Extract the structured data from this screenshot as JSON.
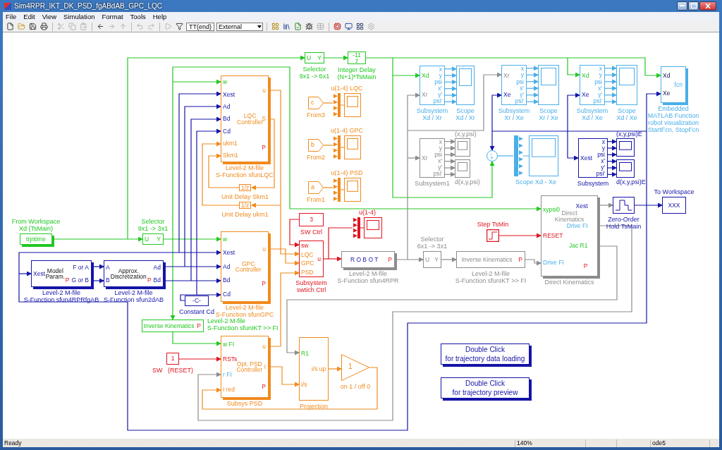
{
  "window": {
    "title": "Sim4RPR_IKT_DK_PSD_fgABdAB_GPC_LQC"
  },
  "menu": [
    "File",
    "Edit",
    "View",
    "Simulation",
    "Format",
    "Tools",
    "Help"
  ],
  "toolbar": {
    "stop_time": "TT(end)",
    "mode": "External"
  },
  "diagram": {
    "blocks": [
      {
        "kind": "block",
        "color": "#f08a1e",
        "inputs": [
          "w",
          "Xest",
          "Ad",
          "Bd",
          "Cd",
          "ukm1",
          "Skm1"
        ],
        "body": [
          "LQC",
          "Controller"
        ],
        "outputs": [
          "u",
          "S",
          "P"
        ],
        "caption": [
          "Level-2 M-file",
          "S-Function sfunLQC"
        ]
      },
      {
        "kind": "block",
        "color": "#22c822",
        "inputs": [
          "U"
        ],
        "outputs": [
          "Y"
        ],
        "caption": [
          "Selector",
          "9x1 -> 6x1"
        ]
      },
      {
        "kind": "block",
        "color": "#22c822",
        "body": [
          "-11",
          "z"
        ],
        "caption": [
          "Integer Delay",
          "(N+1)*TsMain"
        ]
      },
      {
        "kind": "from",
        "color": "#f08a1e",
        "body": [
          "c"
        ],
        "caption": [
          "From3"
        ]
      },
      {
        "kind": "mux_scope",
        "color": "#f08a1e",
        "caption": [
          "u(1-4) LQC"
        ]
      },
      {
        "kind": "block",
        "color": "#4aaee8",
        "inputs": [
          "Xd",
          "Xr"
        ],
        "outputs": [
          "x",
          "y",
          "psi",
          "x'",
          "y'",
          "psi'"
        ],
        "caption": [
          "Subsystem",
          "Xd / Xr"
        ]
      },
      {
        "kind": "scope",
        "color": "#4aaee8",
        "caption": [
          "Scope",
          "Xd / Xr"
        ]
      },
      {
        "kind": "block",
        "color": "#4aaee8",
        "inputs": [
          "Xr",
          "Xe"
        ],
        "outputs": [
          "x",
          "y",
          "psi",
          "x'",
          "y'",
          "psi'"
        ],
        "caption": [
          "Subsystem",
          "Xr / Xe"
        ]
      },
      {
        "kind": "scope",
        "color": "#4aaee8",
        "caption": [
          "Scope",
          "Xr / Xe"
        ]
      },
      {
        "kind": "block",
        "color": "#4aaee8",
        "inputs": [
          "Xd",
          "Xe"
        ],
        "outputs": [
          "x",
          "y",
          "psi",
          "x'",
          "y'",
          "psi'"
        ],
        "caption": [
          "Subsystem",
          "Xd / Xe"
        ]
      },
      {
        "kind": "scope",
        "color": "#4aaee8",
        "caption": [
          "Scope",
          "Xd / Xe"
        ]
      },
      {
        "kind": "block",
        "color": "#4aaee8",
        "inputs": [
          "Xd",
          "Xe"
        ],
        "body": [
          "fcn"
        ],
        "caption": [
          "Embedded",
          "MATLAB Function",
          "robot visualization",
          "StartFcn, StopFcn"
        ]
      },
      {
        "kind": "from",
        "color": "#f08a1e",
        "body": [
          "b"
        ],
        "caption": [
          "From2"
        ]
      },
      {
        "kind": "mux_scope",
        "color": "#f08a1e",
        "caption": [
          "u(1-4) GPC"
        ]
      },
      {
        "kind": "block",
        "color": "#f08a1e",
        "body": [
          "1/z"
        ],
        "caption": [
          "Unit Delay Skm1"
        ]
      },
      {
        "kind": "from",
        "color": "#f08a1e",
        "body": [
          "a"
        ],
        "caption": [
          "From1"
        ]
      },
      {
        "kind": "mux_scope",
        "color": "#f08a1e",
        "caption": [
          "u(1-4) PSD"
        ]
      },
      {
        "kind": "block",
        "color": "#8c8c8c",
        "inputs": [
          "Xr"
        ],
        "outputs": [
          "x",
          "y",
          "psi",
          "x'",
          "y'",
          "psi'"
        ],
        "caption": [
          "Subsystem1"
        ]
      },
      {
        "kind": "scope_pair",
        "color": "#8c8c8c",
        "captions": [
          "(x,y,psi)",
          "d(x,y,psi)"
        ]
      },
      {
        "kind": "sum",
        "color": "#4aaee8",
        "signs": [
          "-",
          "+"
        ]
      },
      {
        "kind": "mux_scope",
        "color": "#4aaee8",
        "caption": [
          "Scope Xd - Xe"
        ]
      },
      {
        "kind": "block",
        "color": "#1414a8",
        "inputs": [
          "Xest"
        ],
        "outputs": [
          "x",
          "y",
          "psi",
          "x'",
          "y'",
          "psi'"
        ],
        "caption": [
          "Subsystem"
        ]
      },
      {
        "kind": "scope_pair",
        "color": "#1414a8",
        "captions": [
          "(x,y,psi)E",
          "d(x,y,psi)E"
        ]
      },
      {
        "kind": "block",
        "color": "#f08a1e",
        "body": [
          "1/z"
        ],
        "caption": [
          "Unit Delay ukm1"
        ]
      },
      {
        "kind": "block",
        "color": "#22c822",
        "body": [
          "trjntime"
        ],
        "caption": [
          "From Workspace",
          "Xd (TsMain)"
        ]
      },
      {
        "kind": "block",
        "color": "#22c822",
        "inputs": [
          "U"
        ],
        "outputs": [
          "Y"
        ],
        "caption": [
          "Selector",
          "9x1 -> 3x1"
        ]
      },
      {
        "kind": "block",
        "color": "#e0141e",
        "body": [
          "3"
        ],
        "caption": [
          "SW Ctrl"
        ]
      },
      {
        "kind": "mux_scope",
        "color": "#e0141e",
        "caption": [
          "u(1-4)"
        ]
      },
      {
        "kind": "step",
        "color": "#e0141e",
        "caption": [
          "Step TsMin"
        ]
      },
      {
        "kind": "block",
        "color": "#8c8c8c",
        "inputs": [
          "xypsi0",
          "RESET",
          "Drive FI"
        ],
        "body": [
          "Direct",
          "Kinematics"
        ],
        "outputs": [
          "Xest",
          "Drive FI",
          "Jac R1",
          "P"
        ],
        "caption": [
          "Direct Kinematics"
        ]
      },
      {
        "kind": "zoh",
        "color": "#1414a8",
        "caption": [
          "Zero-Order",
          "Hold TsMain"
        ]
      },
      {
        "kind": "block",
        "color": "#1414a8",
        "body": [
          "XXX"
        ],
        "caption": [
          "To Workspace"
        ]
      },
      {
        "kind": "block",
        "color": "#1414a8",
        "inputs": [
          "Xest"
        ],
        "body": [
          "Model",
          "Param."
        ],
        "outputs": [
          "F or A",
          {
            "label": "G or B",
            "prefix": "P"
          }
        ],
        "caption": [
          "Level-2 M-file",
          "S-Function sfun4RPRfgAB"
        ]
      },
      {
        "kind": "block",
        "color": "#1414a8",
        "inputs": [
          "A",
          "B"
        ],
        "body": [
          "Approx.",
          "Discretization"
        ],
        "outputs": [
          "Ad",
          {
            "label": "Bd",
            "prefix": "P"
          }
        ],
        "caption": [
          "Level-2 M-file",
          "S-Function sfun2dAB"
        ]
      },
      {
        "kind": "block",
        "color": "#f08a1e",
        "inputs": [
          "w",
          "Xest",
          "Ad",
          "Bd",
          "Cd"
        ],
        "body": [
          "GPC",
          "Controller"
        ],
        "outputs": [
          "u",
          "P"
        ],
        "caption": [
          "Level-2 M-file",
          "S-Function sfunGPC"
        ]
      },
      {
        "kind": "block",
        "color": "#e0141e",
        "inputs": [
          "sw",
          "LQC",
          "GPC",
          "PSD"
        ],
        "outputs": [
          "u"
        ],
        "caption": [
          "Subsystem",
          "swtich Ctrl"
        ]
      },
      {
        "kind": "block",
        "color": "#8c8c8c",
        "inputs": [
          "U"
        ],
        "outputs": [
          "Y"
        ],
        "caption": [
          "Selector",
          "6x1 -> 3x1"
        ]
      },
      {
        "kind": "block",
        "color": "#8c8c8c",
        "body": [
          "R O B O T"
        ],
        "outputs": [
          "P"
        ],
        "caption": [
          "Level-2 M-file",
          "S-Function sfun4RPR"
        ]
      },
      {
        "kind": "block",
        "color": "#8c8c8c",
        "body": [
          "Inverse Kinematics"
        ],
        "outputs": [
          "P"
        ],
        "caption": [
          "Level-2 M-file",
          "S-Function sfunIKT >> FI"
        ]
      },
      {
        "kind": "block",
        "color": "#1414a8",
        "body": [
          "-C-"
        ],
        "caption": [
          "Constant Cd"
        ]
      },
      {
        "kind": "block",
        "color": "#22c822",
        "body": [
          "Inverse Kinematics"
        ],
        "outputs": [
          "P"
        ],
        "caption": [
          "Level-2 M-file",
          "S-Function sfunIKT >> FI"
        ]
      },
      {
        "kind": "block",
        "color": "#e0141e",
        "body": [
          "1"
        ],
        "caption": [
          "SW   (RESET)"
        ]
      },
      {
        "kind": "block",
        "color": "#f08a1e",
        "inputs": [
          "w FI",
          "RSTs",
          "r FI",
          "I red"
        ],
        "body": [
          "Opt. PSD",
          "Controller"
        ],
        "outputs": [
          "u",
          "I",
          "P"
        ],
        "caption": [
          "Subsys PSD"
        ]
      },
      {
        "kind": "block",
        "color": "#f08a1e",
        "inputs": [
          "R1",
          "i/s"
        ],
        "outputs": [
          "i/s up"
        ],
        "caption": [
          "Projection"
        ]
      },
      {
        "kind": "gain",
        "color": "#f08a1e",
        "body": [
          "1"
        ],
        "caption": [
          "on 1 / off 0"
        ]
      },
      {
        "kind": "button",
        "color": "#1414a8",
        "body": [
          "Double Click",
          "for trajectory data loading"
        ]
      },
      {
        "kind": "button",
        "color": "#1414a8",
        "body": [
          "Double Click",
          "for trajectory preview"
        ]
      }
    ]
  },
  "status_bar": {
    "message": "Ready",
    "zoom": "140%",
    "solver": "ode5"
  }
}
